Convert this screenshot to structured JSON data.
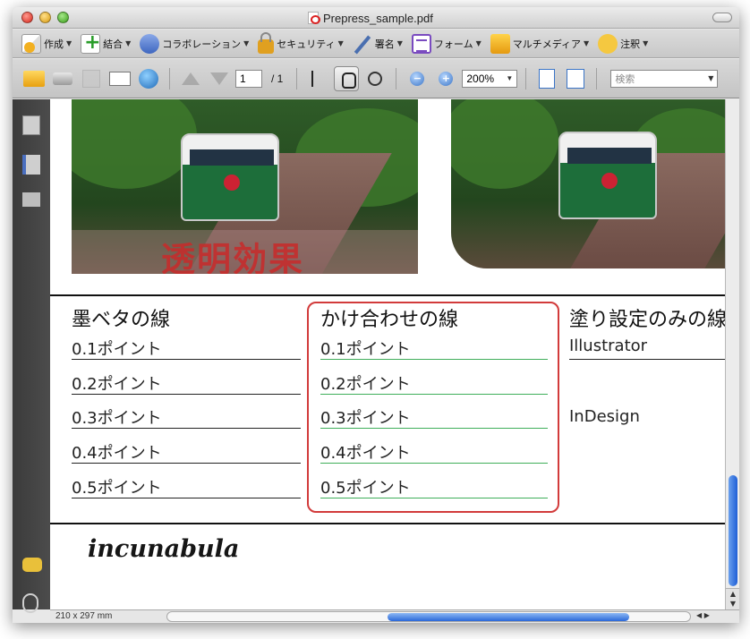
{
  "window": {
    "title": "Prepress_sample.pdf"
  },
  "toolbar_main": {
    "items": [
      {
        "label": "作成",
        "icon": "create-pdf-icon"
      },
      {
        "label": "結合",
        "icon": "combine-icon"
      },
      {
        "label": "コラボレーション",
        "icon": "collaborate-icon"
      },
      {
        "label": "セキュリティ",
        "icon": "lock-icon"
      },
      {
        "label": "署名",
        "icon": "pen-icon"
      },
      {
        "label": "フォーム",
        "icon": "form-icon"
      },
      {
        "label": "マルチメディア",
        "icon": "multimedia-icon"
      },
      {
        "label": "注釈",
        "icon": "comment-icon"
      }
    ]
  },
  "toolbar_nav": {
    "page_current": "1",
    "page_total": "/  1",
    "zoom": "200%",
    "search_placeholder": "検索"
  },
  "document": {
    "effect_label": "透明効果",
    "columns": [
      {
        "heading": "墨ベタの線",
        "rows": [
          "0.1ポイント",
          "0.2ポイント",
          "0.3ポイント",
          "0.4ポイント",
          "0.5ポイント"
        ]
      },
      {
        "heading": "かけ合わせの線",
        "rows": [
          "0.1ポイント",
          "0.2ポイント",
          "0.3ポイント",
          "0.4ポイント",
          "0.5ポイント"
        ]
      },
      {
        "heading": "塗り設定のみの線",
        "rows": [
          "Illustrator",
          "InDesign"
        ]
      }
    ],
    "logo": "incunabula"
  },
  "status": {
    "page_size": "210 x 297 mm"
  },
  "colors": {
    "highlight_border": "#d23b3b",
    "green_line": "#3fae5a",
    "effect_text": "#c92a2a",
    "scroll_thumb": "#1f5fd6"
  }
}
